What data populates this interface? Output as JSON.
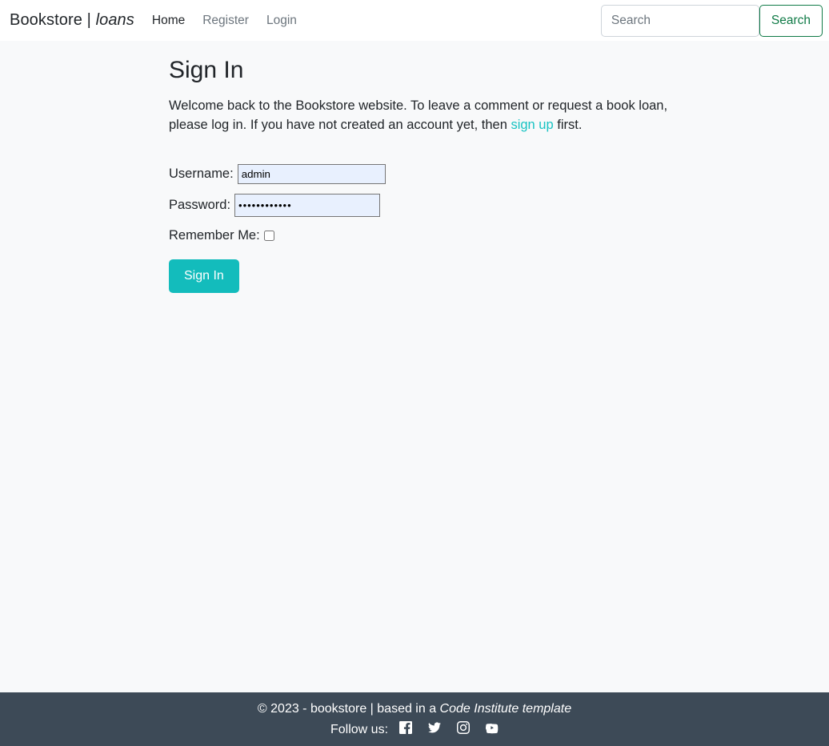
{
  "navbar": {
    "brand_main": "Bookstore | ",
    "brand_emphasis": "loans",
    "links": [
      {
        "label": "Home",
        "active": true
      },
      {
        "label": "Register",
        "active": false
      },
      {
        "label": "Login",
        "active": false
      }
    ],
    "search": {
      "placeholder": "Search",
      "value": "",
      "button_label": "Search",
      "button_color": "#0f7a46"
    },
    "background": "#ffffff"
  },
  "main": {
    "title": "Sign In",
    "intro_part1": "Welcome back to the Bookstore website. To leave a comment or request a book loan, please log in. If you have not created an account yet, then ",
    "intro_link": "sign up",
    "intro_part2": " first.",
    "link_color": "#19c3c3",
    "form": {
      "username_label": "Username:",
      "username_value": "admin",
      "password_label": "Password:",
      "password_value": "••••••••••••",
      "remember_label": "Remember Me:",
      "remember_checked": false,
      "submit_label": "Sign In",
      "submit_color": "#13bcbc"
    }
  },
  "footer": {
    "copyright_part1": "© 2023 - bookstore | based in a ",
    "copyright_emphasis": "Code Institute template",
    "follow_label": "Follow us:",
    "background": "#3d4a57",
    "socials": [
      {
        "name": "facebook-icon"
      },
      {
        "name": "twitter-icon"
      },
      {
        "name": "instagram-icon"
      },
      {
        "name": "youtube-icon"
      }
    ]
  }
}
